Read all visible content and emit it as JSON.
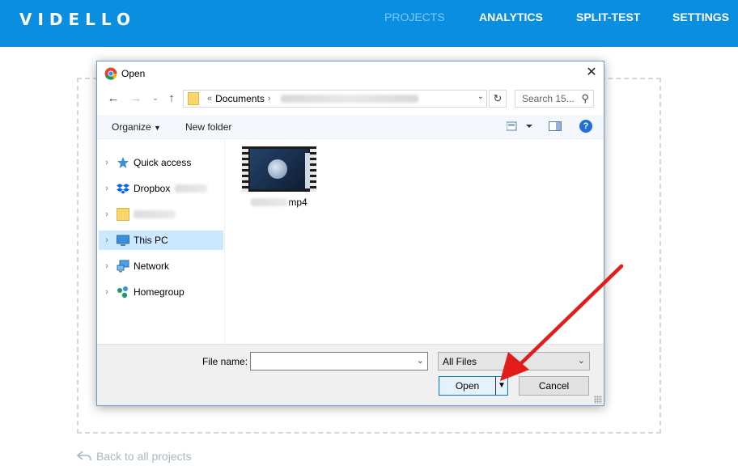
{
  "app": {
    "logo": "VIDELLO",
    "nav": [
      "PROJECTS",
      "ANALYTICS",
      "SPLIT-TEST",
      "SETTINGS"
    ],
    "active_nav": "PROJECTS",
    "accent_color": "#0a8fe0"
  },
  "back_link": "Back to all projects",
  "dialog": {
    "title": "Open",
    "address": {
      "overflow": "«",
      "crumb": "Documents"
    },
    "search_placeholder": "Search 15...",
    "toolbar": {
      "organize": "Organize",
      "new_folder": "New folder"
    },
    "tree": [
      {
        "label": "Quick access",
        "icon": "star-icon"
      },
      {
        "label": "Dropbox",
        "icon": "dropbox-icon"
      },
      {
        "label": "",
        "icon": "folder-icon"
      },
      {
        "label": "This PC",
        "icon": "computer-icon",
        "selected": true
      },
      {
        "label": "Network",
        "icon": "network-icon"
      },
      {
        "label": "Homegroup",
        "icon": "homegroup-icon"
      }
    ],
    "file": {
      "name_suffix": "mp4",
      "type": "video"
    },
    "file_name_label": "File name:",
    "file_name_value": "",
    "filter": "All Files",
    "open_button": "Open",
    "cancel_button": "Cancel"
  },
  "annotation": {
    "arrow_color": "#e31b1b"
  }
}
